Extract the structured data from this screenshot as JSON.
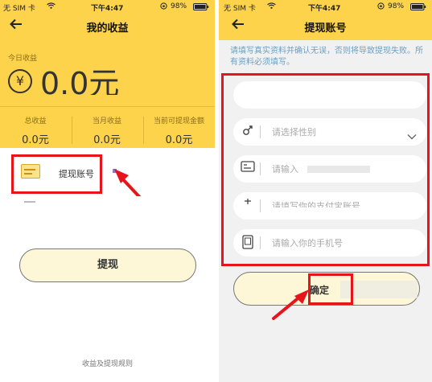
{
  "left": {
    "status": {
      "carrier": "无 SIM 卡",
      "time": "下午4:47",
      "battery": "98%"
    },
    "title": "我的收益",
    "today_label": "今日收益",
    "today_amount": "0.0元",
    "stats": [
      {
        "label": "总收益",
        "value": "0.0元"
      },
      {
        "label": "当月收益",
        "value": "0.0元"
      },
      {
        "label": "当前可提现金额",
        "value": "0.0元"
      }
    ],
    "account_item_label": "提现账号",
    "withdraw_button": "提现",
    "rules_link": "收益及提现规则"
  },
  "right": {
    "status": {
      "carrier": "无 SIM 卡",
      "time": "下午4:47",
      "battery": "98%"
    },
    "title": "提现账号",
    "notice": "请填写真实资料并确认无误，否则将导致提现失败。所有资料必须填写。",
    "fields": [
      {
        "placeholder": ""
      },
      {
        "placeholder": "请选择性别"
      },
      {
        "placeholder": "请输入"
      },
      {
        "placeholder": "请填写你的支付宝账号"
      },
      {
        "placeholder": "请输入你的手机号"
      }
    ],
    "confirm_button": "确定"
  },
  "colors": {
    "brand_yellow": "#fcd34a",
    "annotation_red": "#e8141c",
    "button_cream": "#fdf7d7"
  }
}
